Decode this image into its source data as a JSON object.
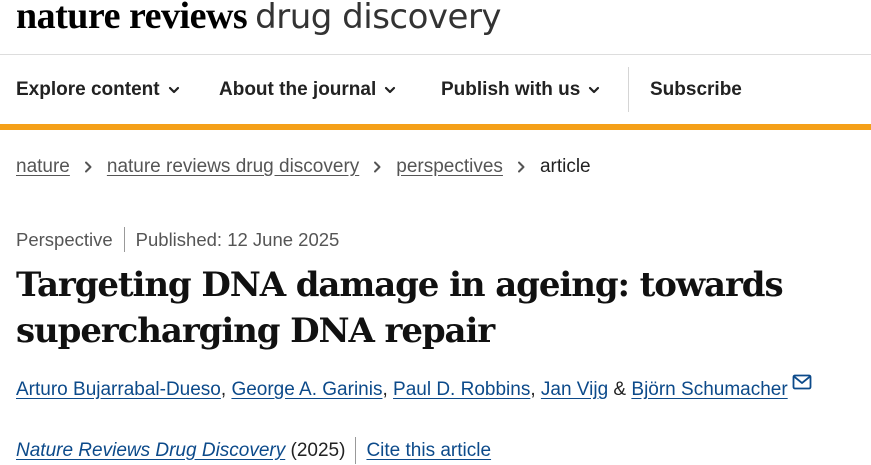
{
  "brand": {
    "bold": "nature reviews",
    "light": "drug discovery"
  },
  "nav": {
    "explore": "Explore content",
    "about": "About the journal",
    "publish": "Publish with us",
    "subscribe": "Subscribe"
  },
  "breadcrumb": [
    "nature",
    "nature reviews drug discovery",
    "perspectives",
    "article"
  ],
  "meta": {
    "type": "Perspective",
    "published": "Published: 12 June 2025"
  },
  "article": {
    "title_line1": "Targeting DNA damage in ageing: towards",
    "title_line2": "supercharging DNA repair"
  },
  "authors": {
    "list": [
      "Arturo Bujarrabal-Dueso",
      "George A. Garinis",
      "Paul D. Robbins",
      "Jan Vijg",
      "Björn Schumacher"
    ],
    "sep": ", ",
    "amp": " & "
  },
  "citation": {
    "journal": "Nature Reviews Drug Discovery",
    "year": "(2025)",
    "cite": "Cite this article"
  },
  "colors": {
    "accent": "#f5a018",
    "link": "#0c4a8a"
  },
  "icons": {
    "nav_chevron": "chevron-down-icon",
    "breadcrumb_sep": "chevron-right-icon",
    "corresponding": "mail-icon"
  }
}
